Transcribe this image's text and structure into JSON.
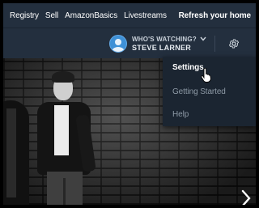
{
  "nav": {
    "links": [
      "Registry",
      "Sell",
      "AmazonBasics",
      "Livestreams"
    ],
    "cta": "Refresh your home"
  },
  "profile": {
    "label": "WHO'S WATCHING?",
    "name": "STEVE LARNER",
    "chevron": "⌄"
  },
  "menu": {
    "items": [
      "Settings",
      "Getting Started",
      "Help"
    ],
    "active_index": 0
  },
  "hero": {
    "next_arrow": "›"
  },
  "colors": {
    "nav_bg": "#232f3e",
    "menu_bg": "#1b2531",
    "avatar": "#3e90d6"
  },
  "icons": [
    "avatar-icon",
    "chevron-down-icon",
    "gear-icon",
    "chevron-right-icon",
    "hand-cursor-icon"
  ]
}
